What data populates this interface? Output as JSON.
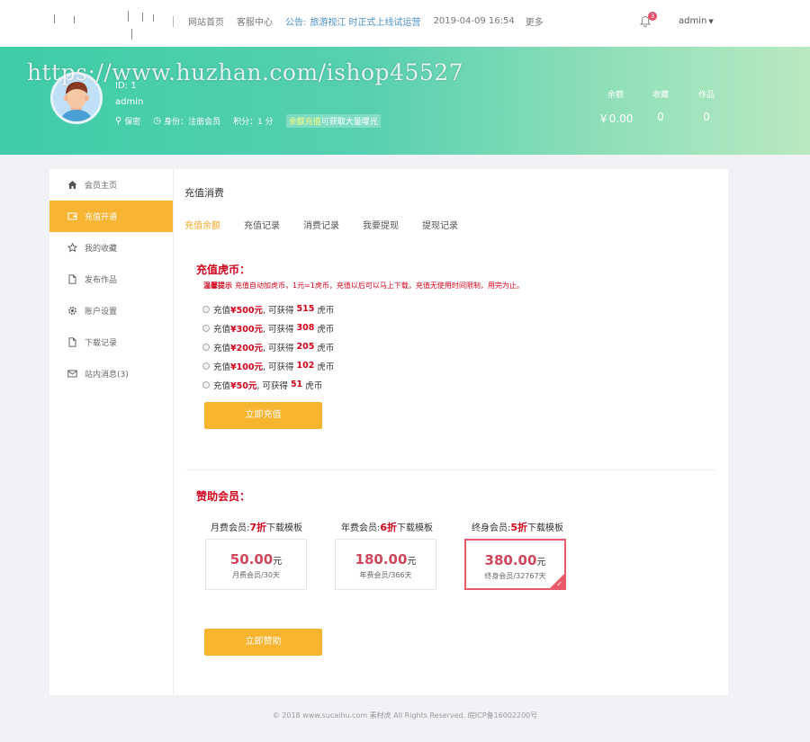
{
  "topnav": {
    "links": [
      "网站首页",
      "客服中心"
    ],
    "notice_label": "公告:",
    "notice_text": "旅游视江    时正式上线试运营",
    "date": "2019-04-09 16:54",
    "more": "更多",
    "bell_count": "3",
    "user": "admin"
  },
  "banner": {
    "watermark": "https://www.huzhan.com/ishop45527",
    "uid": "ID: 1",
    "username": "admin",
    "gender": "保密",
    "identity": "身份：注册会员",
    "points": "积分：1 分",
    "promo_hl": "余额充值",
    "promo_text": "可获取大量曝光",
    "stats": [
      {
        "label": "余额",
        "value": "￥0.00"
      },
      {
        "label": "收藏",
        "value": "0"
      },
      {
        "label": "作品",
        "value": "0"
      }
    ]
  },
  "sidebar": {
    "items": [
      {
        "label": "会员主页",
        "icon": "home-icon"
      },
      {
        "label": "充值开通",
        "icon": "wallet-icon"
      },
      {
        "label": "我的收藏",
        "icon": "star-icon"
      },
      {
        "label": "发布作品",
        "icon": "document-icon"
      },
      {
        "label": "账户设置",
        "icon": "gear-icon"
      },
      {
        "label": "下载记录",
        "icon": "document-icon"
      },
      {
        "label": "站内消息(3)",
        "icon": "mail-icon"
      }
    ],
    "active_index": 1
  },
  "main": {
    "title": "充值消费",
    "tabs": [
      "充值余额",
      "充值记录",
      "消费记录",
      "我要提现",
      "提现记录"
    ],
    "recharge": {
      "title": "充值虎币：",
      "tip_label": "温馨提示",
      "tip_text": "充值自动加虎币，1元=1虎币，充值以后可以马上下载，充值无使用时间限制，用完为止。",
      "options": [
        {
          "pre": "充值",
          "amount": "¥500元",
          "mid": ", 可获得",
          "coins": "515",
          "post": "虎币"
        },
        {
          "pre": "充值",
          "amount": "¥300元",
          "mid": ", 可获得",
          "coins": "308",
          "post": "虎币"
        },
        {
          "pre": "充值",
          "amount": "¥200元",
          "mid": ", 可获得",
          "coins": "205",
          "post": "虎币"
        },
        {
          "pre": "充值",
          "amount": "¥100元",
          "mid": ", 可获得",
          "coins": "102",
          "post": "虎币"
        },
        {
          "pre": "充值",
          "amount": "¥50元",
          "mid": ", 可获得",
          "coins": "51",
          "post": "虎币"
        }
      ],
      "button": "立即充值"
    },
    "sponsor": {
      "title": "赞助会员：",
      "plans": [
        {
          "pre": "月费会员:",
          "discount": "7折",
          "post": "下载模板",
          "price": "50.00",
          "unit": "元",
          "desc": "月费会员/30天",
          "selected": false
        },
        {
          "pre": "年费会员:",
          "discount": "6折",
          "post": "下载模板",
          "price": "180.00",
          "unit": "元",
          "desc": "年费会员/366天",
          "selected": false
        },
        {
          "pre": "终身会员:",
          "discount": "5折",
          "post": "下载模板",
          "price": "380.00",
          "unit": "元",
          "desc": "终身会员/32767天",
          "selected": true
        }
      ],
      "button": "立即赞助"
    }
  },
  "footer": "© 2018 www.sucaihu.com 素材虎 All Rights Reserved. 皖ICP备16002200号"
}
